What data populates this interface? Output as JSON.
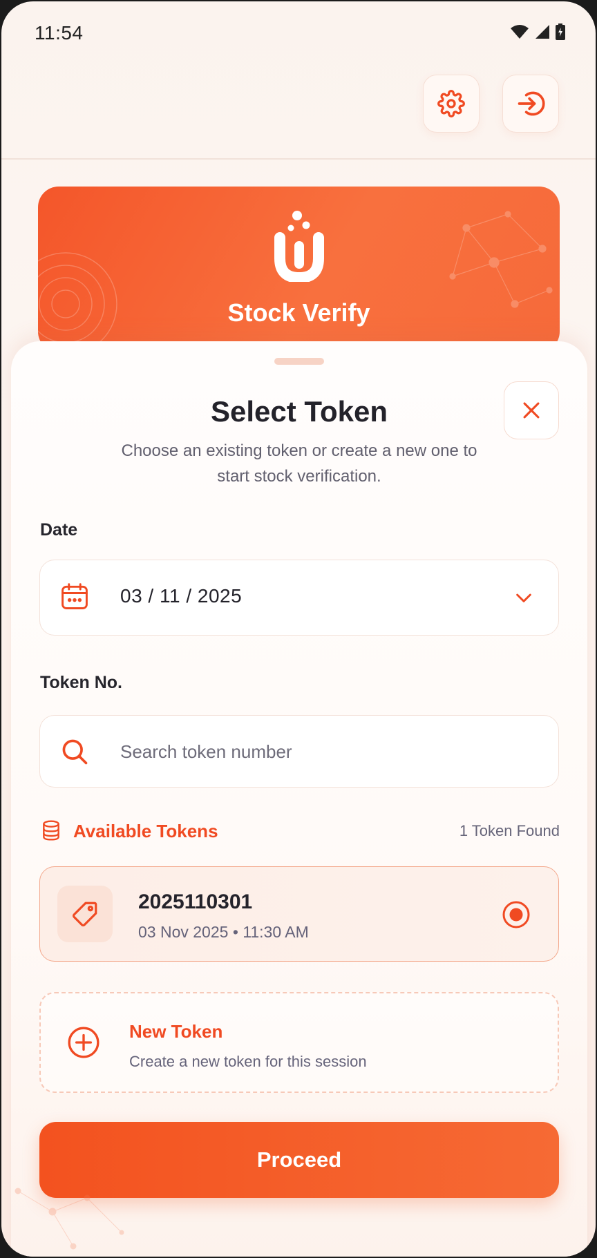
{
  "status": {
    "time": "11:54"
  },
  "brand": {
    "name": "Stock Verify"
  },
  "header": {
    "settings_icon": "gear-icon",
    "login_icon": "sign-in-icon"
  },
  "sheet": {
    "title": "Select Token",
    "subtitle": "Choose an existing token or create a new one to start stock verification.",
    "date": {
      "label": "Date",
      "value": "03 / 11 / 2025"
    },
    "token": {
      "label": "Token No.",
      "placeholder": "Search token number"
    },
    "available": {
      "label": "Available Tokens",
      "count": "1 Token Found",
      "items": [
        {
          "number": "2025110301",
          "meta": "03 Nov 2025 • 11:30 AM",
          "selected": true
        }
      ]
    },
    "new_token": {
      "title": "New Token",
      "description": "Create a new token for this session"
    },
    "proceed_label": "Proceed"
  },
  "colors": {
    "accent": "#F04A22",
    "accent_light": "#F66A34",
    "background": "#FDF6F2"
  }
}
